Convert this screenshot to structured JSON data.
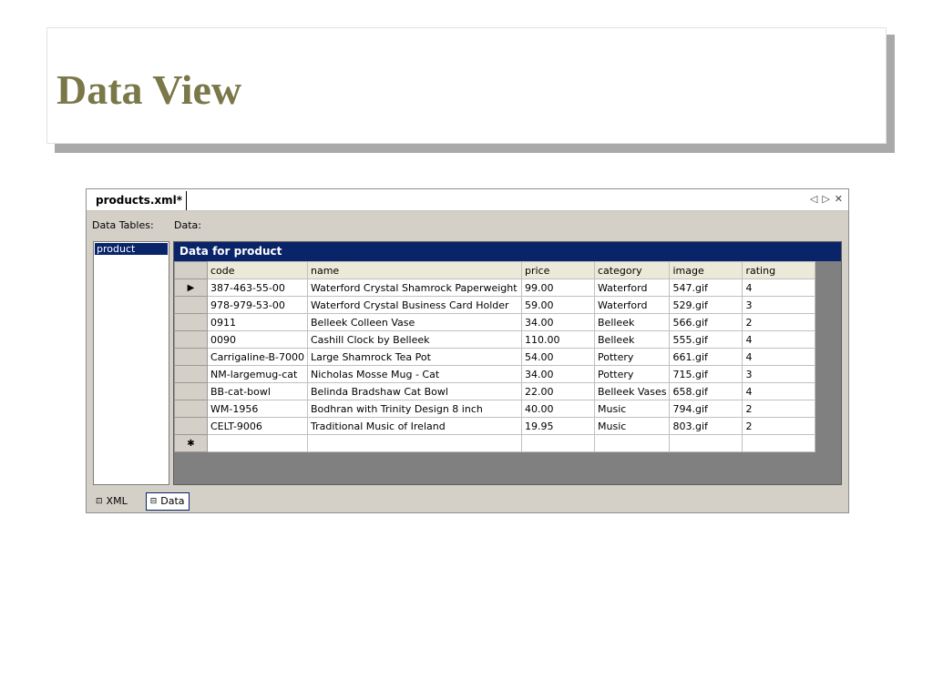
{
  "slide": {
    "title": "Data View"
  },
  "window": {
    "tab_label": "products.xml*",
    "controls": {
      "prev": "◁",
      "next": "▷",
      "close": "✕"
    }
  },
  "labels": {
    "data_tables": "Data Tables:",
    "data": "Data:"
  },
  "tables": [
    "product"
  ],
  "grid": {
    "caption": "Data for product",
    "columns": [
      "code",
      "name",
      "price",
      "category",
      "image",
      "rating"
    ],
    "current_row_marker": "▶",
    "new_row_marker": "✱",
    "rows": [
      [
        "387-463-55-00",
        "Waterford Crystal Shamrock Paperweight",
        "99.00",
        "Waterford",
        "547.gif",
        "4"
      ],
      [
        "978-979-53-00",
        "Waterford Crystal Business Card Holder",
        "59.00",
        "Waterford",
        "529.gif",
        "3"
      ],
      [
        "0911",
        "Belleek Colleen Vase",
        "34.00",
        "Belleek",
        "566.gif",
        "2"
      ],
      [
        "0090",
        "Cashill Clock by Belleek",
        "110.00",
        "Belleek",
        "555.gif",
        "4"
      ],
      [
        "Carrigaline-B-7000",
        "Large Shamrock Tea Pot",
        "54.00",
        "Pottery",
        "661.gif",
        "4"
      ],
      [
        "NM-largemug-cat",
        "Nicholas Mosse Mug - Cat",
        "34.00",
        "Pottery",
        "715.gif",
        "3"
      ],
      [
        "BB-cat-bowl",
        "Belinda Bradshaw Cat Bowl",
        "22.00",
        "Belleek Vases",
        "658.gif",
        "4"
      ],
      [
        "WM-1956",
        "Bodhran with Trinity Design 8 inch",
        "40.00",
        "Music",
        "794.gif",
        "2"
      ],
      [
        "CELT-9006",
        "Traditional Music of Ireland",
        "19.95",
        "Music",
        "803.gif",
        "2"
      ]
    ]
  },
  "bottom_tabs": [
    {
      "label": "XML",
      "icon": "xml-view-icon",
      "active": false
    },
    {
      "label": "Data",
      "icon": "data-view-icon",
      "active": true
    }
  ],
  "colors": {
    "title": "#7a7748",
    "selection": "#0a246a",
    "chrome": "#d4d0c8"
  }
}
